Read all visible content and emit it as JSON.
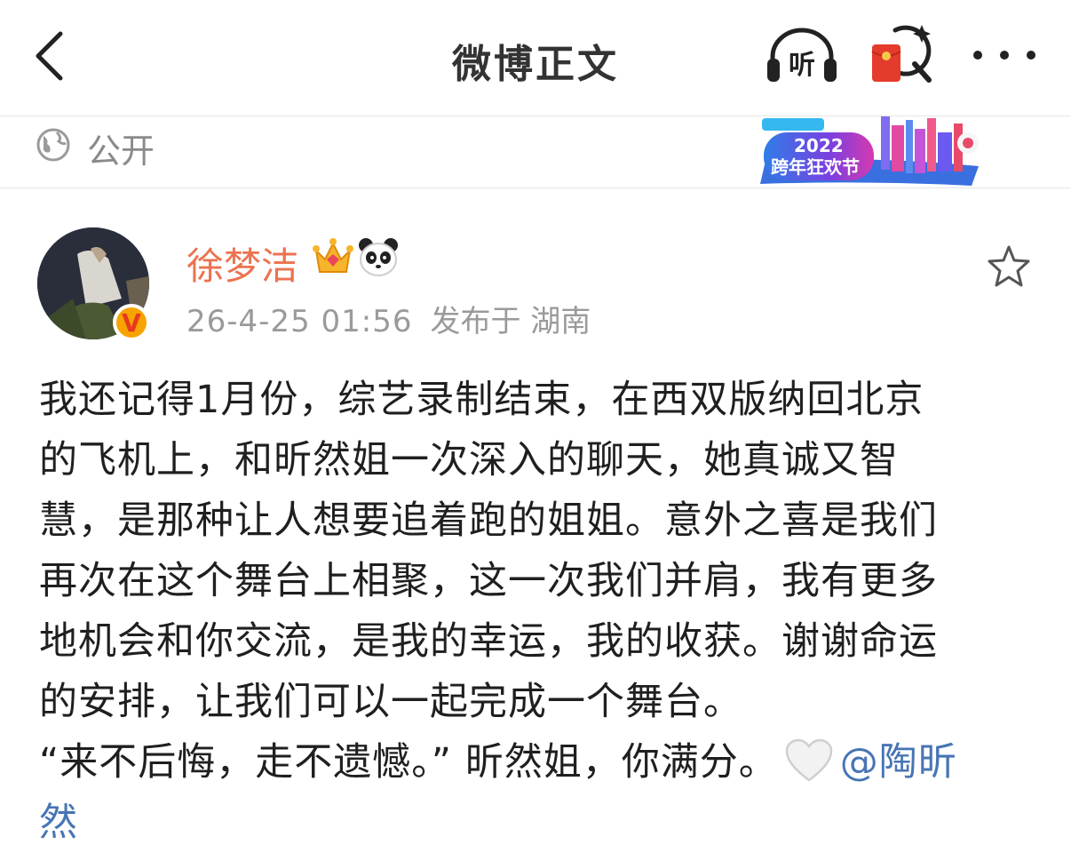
{
  "nav": {
    "title": "微博正文",
    "listen_label": "听"
  },
  "visibility": {
    "label": "公开"
  },
  "banner": {
    "year": "2022",
    "text": "跨年狂欢节"
  },
  "post": {
    "username": "徐梦洁",
    "time": "26-4-25 01:56",
    "location": "发布于 湖南",
    "verified_badge": "V",
    "body_lines": [
      "我还记得1月份，综艺录制结束，在西双版纳回北京",
      "的飞机上，和昕然姐一次深入的聊天，她真诚又智",
      "慧，是那种让人想要追着跑的姐姐。意外之喜是我们",
      "再次在这个舞台上相聚，这一次我们并肩，我有更多",
      "地机会和你交流，是我的幸运，我的收获。谢谢命运",
      "的安排，让我们可以一起完成一个舞台。"
    ],
    "last_line_text": "“来不后悔，走不遗憾。” 昕然姐，你满分。",
    "mention_part1": "@陶昕",
    "mention_part2": "然"
  },
  "icons": {
    "back": "chevron-left-icon",
    "listen": "headphones-icon",
    "redpacket": "red-envelope-search-icon",
    "more": "more-dots-icon",
    "globe": "globe-icon",
    "star": "star-outline-icon",
    "heart": "white-heart-icon"
  },
  "colors": {
    "username": "#eb7350",
    "mention": "#4775b4",
    "secondary_text": "#9a9a9a"
  }
}
